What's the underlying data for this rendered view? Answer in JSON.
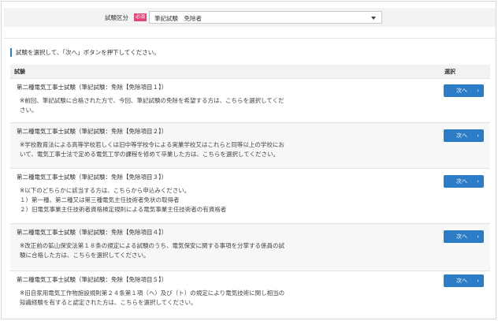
{
  "filter": {
    "label": "試験区分",
    "required_badge": "必須",
    "selected_value": "筆記試験　免除者"
  },
  "instruction": "試験を選択して、「次へ」ボタンを押下してください。",
  "table": {
    "header_exam": "試験",
    "header_select": "選択",
    "next_label": "次へ",
    "rows": [
      {
        "title": "第二種電気工事士試験（筆記試験：免除【免除項目１】）",
        "desc": [
          "※前回、筆記試験に合格された方で、今回、筆記試験の免除を希望する方は、こちらを選択してくだ",
          "さい。"
        ]
      },
      {
        "title": "第二種電気工事士試験（筆記試験：免除【免除項目２】）",
        "desc": [
          "※学校教育法による高等学校若しくは旧中等学校令による実業学校又はこれらと同等以上の学校にお",
          "いて、電気工事士法で定める電気工学の課程を修めて卒業した方は、こちらを選択してください。"
        ]
      },
      {
        "title": "第二種電気工事士試験（筆記試験：免除【免除項目３】）",
        "desc": [
          "※以下のどちらかに該当する方は、こちらから申込みください。",
          "１）第一種、第二種又は第三種電気主任技術者免状の取得者",
          "２）旧電気事業主任技術者資格検定規則による電気事業主任技術者の有資格者"
        ]
      },
      {
        "title": "第二種電気工事士試験（筆記試験：免除【免除項目４】）",
        "desc": [
          "※改正前の鉱山保安法第１８条の規定による試験のうち、電気保安に関する事項を分掌する係員の試",
          "験に合格した方は、こちらを選択してください。"
        ]
      },
      {
        "title": "第二種電気工事士試験（筆記試験：免除【免除項目５】）",
        "desc": [
          "※旧自家用電気工作物施設規則第２４条第１項（ヘ）及び（ト）の規定により電気技術に関し相当の",
          "知識経験を有すると認定された方は、こちらを選択してください。"
        ]
      }
    ]
  },
  "colors": {
    "accent": "#2c7cc6",
    "required": "#e0457a"
  }
}
